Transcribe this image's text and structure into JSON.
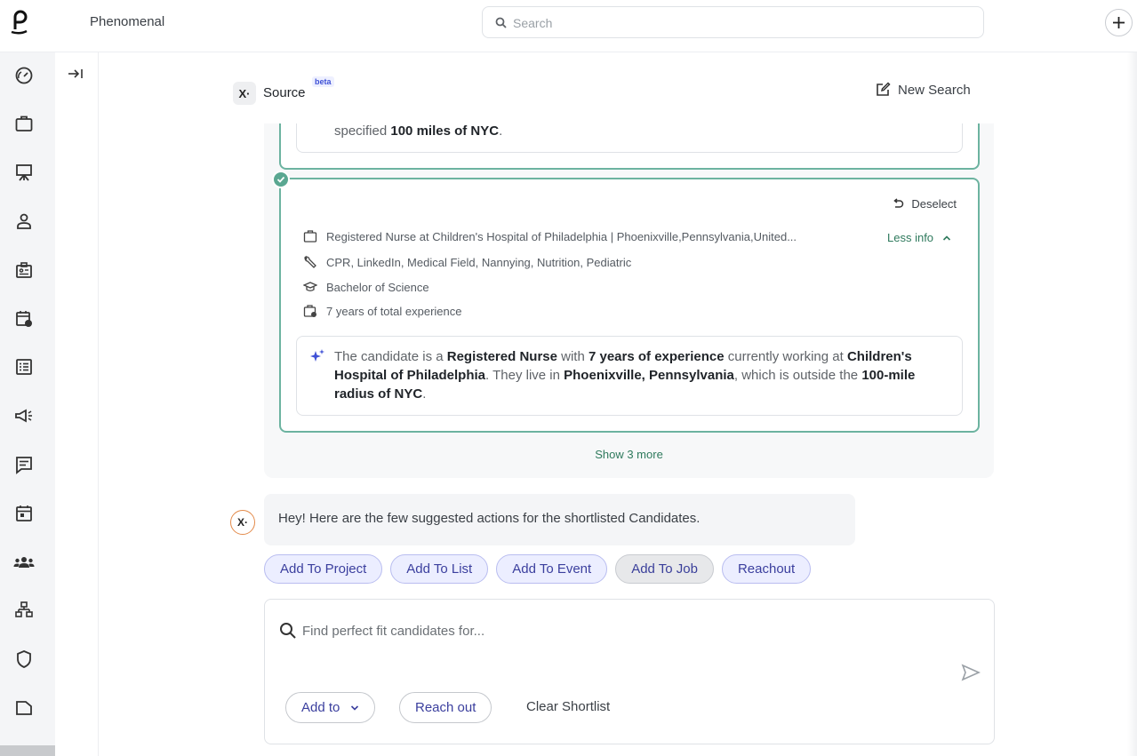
{
  "app": {
    "name": "Phenomenal"
  },
  "topbar": {
    "search_placeholder": "Search"
  },
  "sidebar": {
    "items": [
      {
        "name": "dashboard-icon"
      },
      {
        "name": "briefcase-icon"
      },
      {
        "name": "presentation-icon"
      },
      {
        "name": "person-icon"
      },
      {
        "name": "id-badge-icon"
      },
      {
        "name": "calendar-clock-icon"
      },
      {
        "name": "list-icon"
      },
      {
        "name": "megaphone-icon"
      },
      {
        "name": "message-icon"
      },
      {
        "name": "calendar-icon"
      },
      {
        "name": "people-icon"
      },
      {
        "name": "org-chart-icon"
      },
      {
        "name": "shield-icon"
      },
      {
        "name": "folder-icon"
      }
    ]
  },
  "source": {
    "badge": "X·",
    "title": "Source",
    "beta": "beta",
    "new_search": "New Search"
  },
  "previous_card": {
    "text_prefix": "specified ",
    "text_bold": "100 miles of NYC",
    "text_suffix": "."
  },
  "candidate": {
    "deselect": "Deselect",
    "less_info": "Less info",
    "title": "Registered Nurse at Children's Hospital of Philadelphia | Phoenixville,Pennsylvania,United...",
    "skills": "CPR, LinkedIn, Medical Field, Nannying, Nutrition, Pediatric",
    "education": "Bachelor of Science",
    "experience": "7 years of total experience",
    "summary": {
      "p1": "The candidate is a ",
      "b1": "Registered Nurse",
      "p2": " with ",
      "b2": "7 years of experience",
      "p3": " currently working at ",
      "b3": "Children's Hospital of Philadelphia",
      "p4": ". They live in ",
      "b4": "Phoenixville, Pennsylvania",
      "p5": ", which is outside the ",
      "b5": "100-mile radius of NYC",
      "p6": "."
    }
  },
  "show_more": "Show 3 more",
  "assistant": {
    "avatar": "X·",
    "message": "Hey! Here are the few suggested actions for the shortlisted Candidates."
  },
  "actions": [
    "Add To Project",
    "Add To List",
    "Add To Event",
    "Add To Job",
    "Reachout"
  ],
  "composer": {
    "placeholder": "Find perfect fit candidates for...",
    "add_to": "Add to",
    "reach_out": "Reach out",
    "clear": "Clear Shortlist"
  },
  "colors": {
    "accent_green": "#5aa791",
    "chip_purple": "#3b3f9e",
    "chip_bg": "#eceeff"
  }
}
